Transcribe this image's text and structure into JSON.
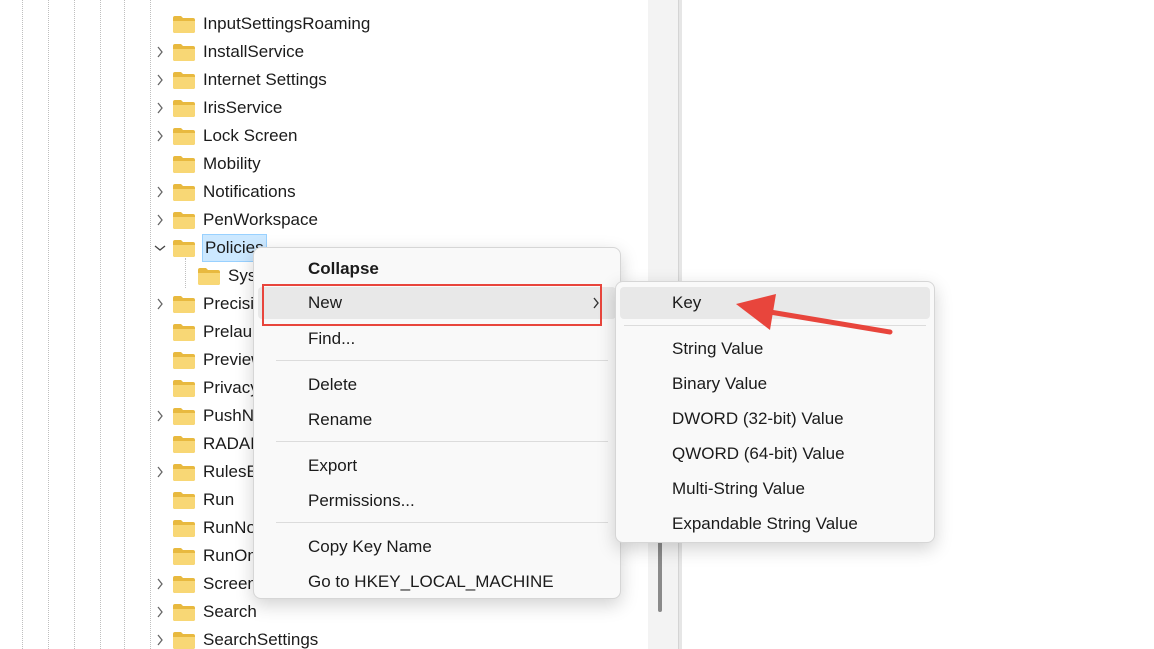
{
  "tree": {
    "items": [
      {
        "label": "InputSettingsRoaming",
        "expander": "none"
      },
      {
        "label": "InstallService",
        "expander": "collapsed"
      },
      {
        "label": "Internet Settings",
        "expander": "collapsed"
      },
      {
        "label": "IrisService",
        "expander": "collapsed"
      },
      {
        "label": "Lock Screen",
        "expander": "collapsed"
      },
      {
        "label": "Mobility",
        "expander": "none"
      },
      {
        "label": "Notifications",
        "expander": "collapsed"
      },
      {
        "label": "PenWorkspace",
        "expander": "collapsed"
      },
      {
        "label": "Policies",
        "expander": "expanded",
        "selected": true
      },
      {
        "label": "Sys",
        "expander": "none",
        "child": true
      },
      {
        "label": "Precisi",
        "expander": "collapsed"
      },
      {
        "label": "Prelaur",
        "expander": "none"
      },
      {
        "label": "Preview",
        "expander": "none"
      },
      {
        "label": "Privacy",
        "expander": "none"
      },
      {
        "label": "PushN",
        "expander": "collapsed"
      },
      {
        "label": "RADAR",
        "expander": "none"
      },
      {
        "label": "RulesE",
        "expander": "collapsed"
      },
      {
        "label": "Run",
        "expander": "none"
      },
      {
        "label": "RunNo",
        "expander": "none"
      },
      {
        "label": "RunOn",
        "expander": "none"
      },
      {
        "label": "Screen",
        "expander": "collapsed"
      },
      {
        "label": "Search",
        "expander": "collapsed"
      },
      {
        "label": "SearchSettings",
        "expander": "collapsed"
      }
    ]
  },
  "context_menu": {
    "collapse": "Collapse",
    "new": "New",
    "find": "Find...",
    "delete": "Delete",
    "rename": "Rename",
    "export": "Export",
    "permissions": "Permissions...",
    "copy_key_name": "Copy Key Name",
    "goto": "Go to HKEY_LOCAL_MACHINE"
  },
  "submenu": {
    "key": "Key",
    "string_value": "String Value",
    "binary_value": "Binary Value",
    "dword": "DWORD (32-bit) Value",
    "qword": "QWORD (64-bit) Value",
    "multi_string": "Multi-String Value",
    "expandable_string": "Expandable String Value"
  },
  "icons": {
    "folder": "folder-icon",
    "expander_collapsed": "chevron-right-icon",
    "expander_expanded": "chevron-down-icon",
    "submenu_arrow": "chevron-right-icon",
    "annotation": "red-arrow-icon"
  },
  "colors": {
    "folder_fill": "#f8d775",
    "folder_tab": "#e8b93f",
    "selection_bg": "#cce8ff",
    "annotation_red": "#e8453c"
  }
}
